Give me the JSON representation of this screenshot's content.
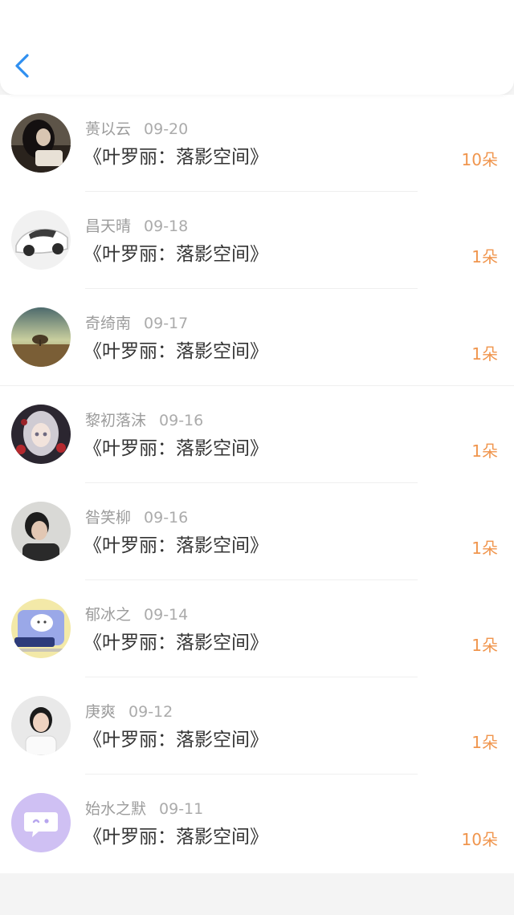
{
  "colors": {
    "accent": "#2f8ff0",
    "count": "#f0954d",
    "name": "#9c9c9c",
    "title": "#333333"
  },
  "header": {
    "back_icon": "chevron-left-icon"
  },
  "items": [
    {
      "name": "蒉以云",
      "date": "09-20",
      "title": "《叶罗丽：落影空间》",
      "count": "10朵"
    },
    {
      "name": "昌天晴",
      "date": "09-18",
      "title": "《叶罗丽：落影空间》",
      "count": "1朵"
    },
    {
      "name": "奇绮南",
      "date": "09-17",
      "title": "《叶罗丽：落影空间》",
      "count": "1朵"
    },
    {
      "name": "黎初落沫",
      "date": "09-16",
      "title": "《叶罗丽：落影空间》",
      "count": "1朵"
    },
    {
      "name": "昝笑柳",
      "date": "09-16",
      "title": "《叶罗丽：落影空间》",
      "count": "1朵"
    },
    {
      "name": "郁冰之",
      "date": "09-14",
      "title": "《叶罗丽：落影空间》",
      "count": "1朵"
    },
    {
      "name": "庚爽",
      "date": "09-12",
      "title": "《叶罗丽：落影空间》",
      "count": "1朵"
    },
    {
      "name": "始水之默",
      "date": "09-11",
      "title": "《叶罗丽：落影空间》",
      "count": "10朵"
    }
  ]
}
